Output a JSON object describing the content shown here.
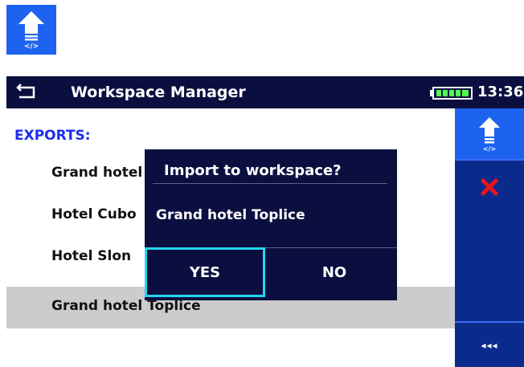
{
  "top_icon": {
    "name": "import-workspace-icon"
  },
  "header": {
    "title": "Workspace Manager",
    "time": "13:36",
    "back_icon": "back-arrow-icon",
    "battery_icon": "battery-full-icon"
  },
  "content": {
    "section_label": "EXPORTS:",
    "items": [
      {
        "label": "Grand hotel Toplice"
      },
      {
        "label": "Hotel Cubo"
      },
      {
        "label": "Hotel Slon"
      },
      {
        "label": "Grand hotel Toplice",
        "selected": true
      }
    ]
  },
  "dialog": {
    "title": "Import to workspace?",
    "message": "Grand hotel Toplice",
    "yes_label": "YES",
    "no_label": "NO"
  },
  "sidebar": {
    "buttons": [
      "import-icon",
      "delete-icon",
      "more-icon"
    ],
    "more_label": "◂◂◂"
  },
  "colors": {
    "header_bg": "#0b0f3f",
    "sidebar_bg": "#0b2b8c",
    "accent_blue": "#1d63f0",
    "section_label": "#1b2cf0",
    "selected_row": "#cccccc",
    "yes_border": "#22d6f0",
    "delete_red": "#e8141c"
  }
}
